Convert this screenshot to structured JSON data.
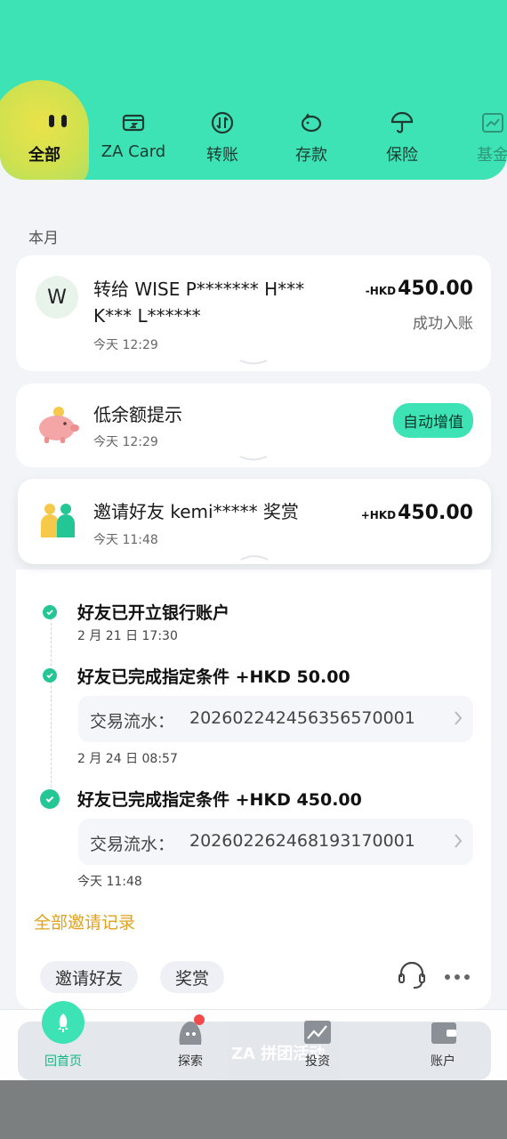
{
  "tabs": [
    {
      "label": "全部",
      "icon": "face-icon",
      "active": true
    },
    {
      "label": "ZA Card",
      "icon": "card-icon"
    },
    {
      "label": "转账",
      "icon": "transfer-icon"
    },
    {
      "label": "存款",
      "icon": "piggy-bank-icon"
    },
    {
      "label": "保险",
      "icon": "umbrella-icon"
    },
    {
      "label": "基金",
      "icon": "chart-icon"
    }
  ],
  "section": {
    "month": "本月"
  },
  "transfer": {
    "avatar": "W",
    "title_line1": "转给 WISE P******* H***",
    "title_line2": "K*** L******",
    "time": "今天 12:29",
    "currency": "-HKD",
    "amount": "450.00",
    "status": "成功入账"
  },
  "low_balance": {
    "title": "低余额提示",
    "time": "今天 12:29",
    "button": "自动增值"
  },
  "invite": {
    "title": "邀请好友 kemi***** 奖赏",
    "time": "今天 11:48",
    "currency": "+HKD",
    "amount": "450.00",
    "steps": [
      {
        "title": "好友已开立银行账户",
        "date": "2 月 21 日 17:30"
      },
      {
        "title": "好友已完成指定条件 +HKD 50.00",
        "tx_label": "交易流水：",
        "tx_id": "20260224245635657000​1",
        "date": "2 月 24 日 08:57"
      },
      {
        "title": "好友已完成指定条件 +HKD 450.00",
        "tx_label": "交易流水：",
        "tx_id": "202602262468193170001",
        "date": "今天 11:48"
      }
    ],
    "all_records": "全部邀请记录",
    "chips": [
      "邀请好友",
      "奖赏"
    ]
  },
  "banner": {
    "text": "ZA 拼团活动"
  },
  "bottom_nav": [
    {
      "label": "回首页",
      "icon": "rocket-icon",
      "active": true
    },
    {
      "label": "探索",
      "icon": "explore-icon",
      "badge": true
    },
    {
      "label": "投资",
      "icon": "invest-icon"
    },
    {
      "label": "账户",
      "icon": "wallet-icon"
    }
  ],
  "colors": {
    "accent": "#3de3b4",
    "link": "#e2a11a",
    "check": "#23c694"
  }
}
